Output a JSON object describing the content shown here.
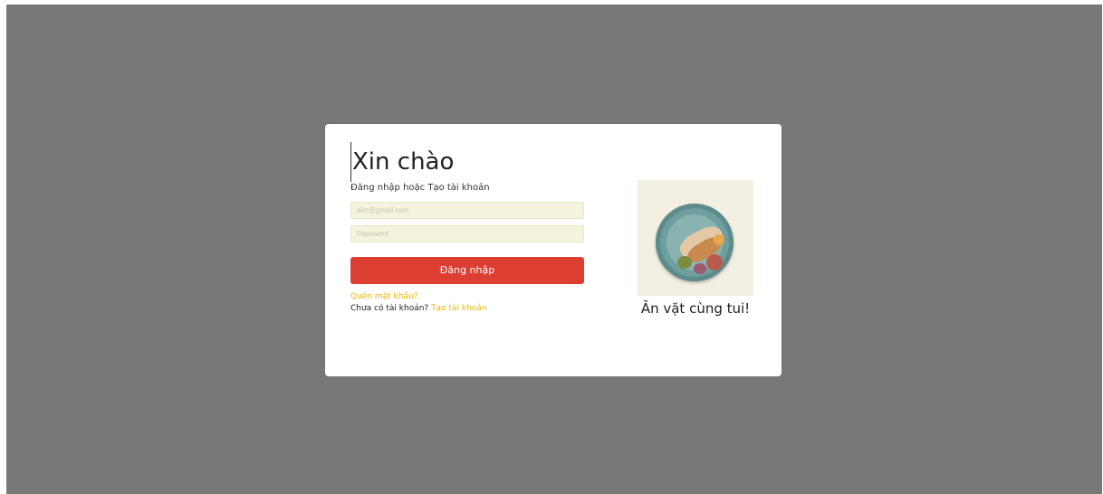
{
  "login": {
    "title": "Xin chào",
    "subtitle": "Đăng nhập hoặc Tạo tài khoản",
    "email_placeholder": "abc@gmail.com",
    "password_placeholder": "Password",
    "submit_label": "Đăng nhập",
    "forgot_label": "Quên mật khẩu?",
    "no_account_text": "Chưa có tài khoản?",
    "register_label": "Tạo tài khoản"
  },
  "promo": {
    "image": "food-plate-image",
    "tagline": "Ăn vặt cùng tui!"
  },
  "colors": {
    "overlay": "#787878",
    "primary_button": "#dc3f32",
    "link": "#e6b800",
    "input_bg": "#f5f3dd"
  }
}
